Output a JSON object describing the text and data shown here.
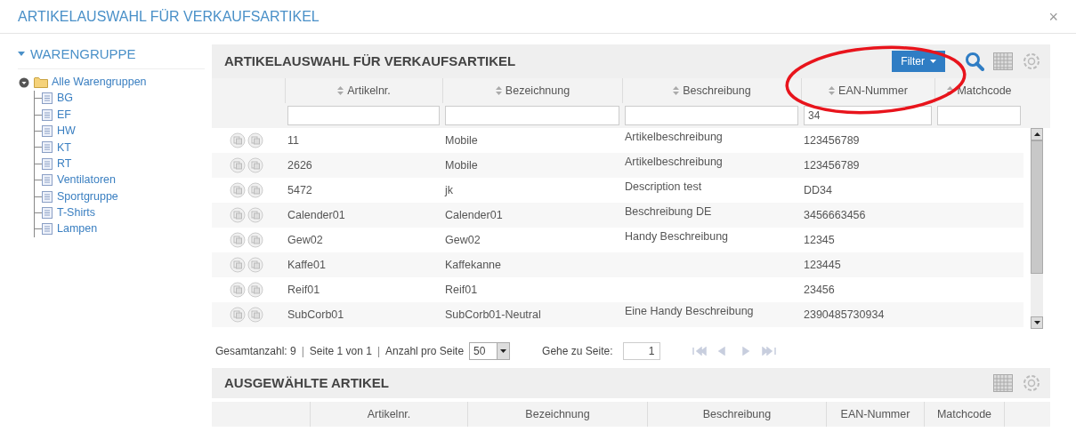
{
  "window": {
    "title": "ARTIKELAUSWAHL FÜR VERKAUFSARTIKEL",
    "close": "×"
  },
  "sidebar": {
    "title": "WARENGRUPPE",
    "expanded": true,
    "tree": {
      "label": "Alle Warengruppen",
      "expanded": true,
      "children": [
        {
          "label": "BG"
        },
        {
          "label": "EF"
        },
        {
          "label": "HW"
        },
        {
          "label": "KT"
        },
        {
          "label": "RT"
        },
        {
          "label": "Ventilatoren"
        },
        {
          "label": "Sportgruppe"
        },
        {
          "label": "T-Shirts"
        },
        {
          "label": "Lampen"
        }
      ]
    }
  },
  "articles_panel": {
    "title": "ARTIKELAUSWAHL FÜR VERKAUFSARTIKEL",
    "filter_button": "Filter",
    "columns": [
      {
        "label": "Artikelnr."
      },
      {
        "label": "Bezeichnung"
      },
      {
        "label": "Beschreibung"
      },
      {
        "label": "EAN-Nummer",
        "filter": "34"
      },
      {
        "label": "Matchcode"
      }
    ],
    "rows": [
      [
        "11",
        "Mobile",
        "Artikelbeschreibung",
        "123456789"
      ],
      [
        "2626",
        "Mobile",
        "Artikelbeschreibung",
        "123456789"
      ],
      [
        "5472",
        "jk",
        "Description test",
        "DD34"
      ],
      [
        "Calender01",
        "Calender01",
        "Beschreibung DE",
        "3456663456"
      ],
      [
        "Gew02",
        "Gew02",
        "Handy Beschreibung",
        "12345"
      ],
      [
        "Kaffe01",
        "Kaffekanne",
        "",
        "123445"
      ],
      [
        "Reif01",
        "Reif01",
        "",
        "23456"
      ],
      [
        "SubCorb01",
        "SubCorb01-Neutral",
        "Eine Handy Beschreibung",
        "2390485730934"
      ]
    ],
    "pager": {
      "total": "Gesamtanzahl: 9",
      "separators": [
        "|",
        "|"
      ],
      "page": "Seite 1 von 1",
      "per_page_label": "Anzahl pro Seite",
      "per_page": "50",
      "goto_label": "Gehe zu Seite:",
      "goto_value": "1"
    }
  },
  "selected_panel": {
    "title": "AUSGEWÄHLTE ARTIKEL",
    "columns": [
      "Artikelnr.",
      "Bezeichnung",
      "Beschreibung",
      "EAN-Nummer",
      "Matchcode"
    ]
  }
}
